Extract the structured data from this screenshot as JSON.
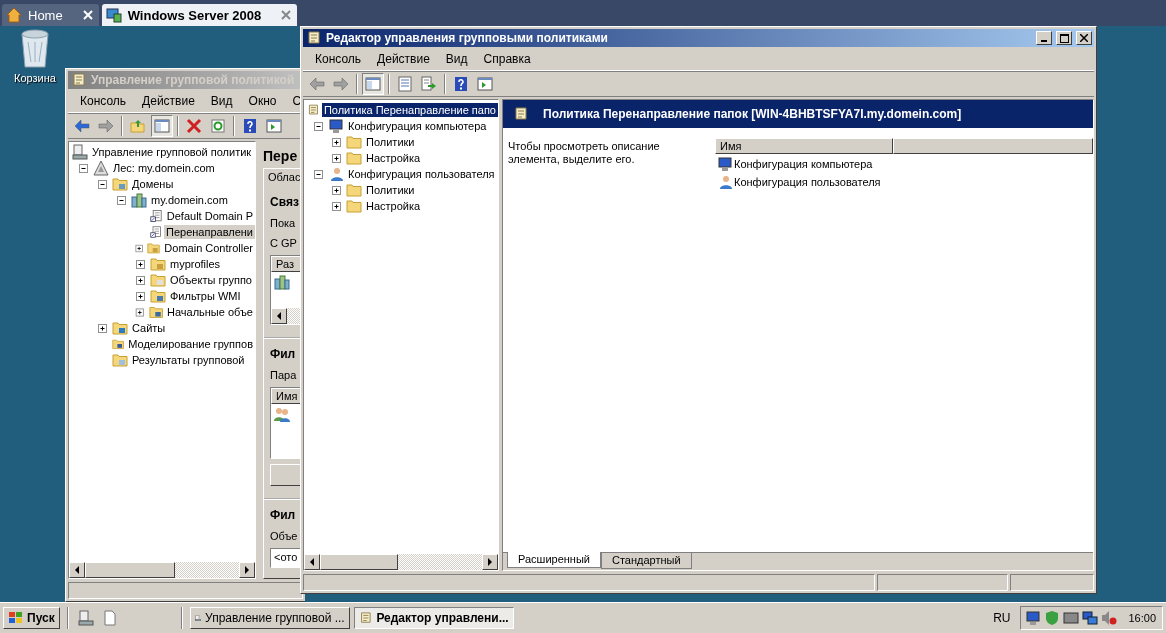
{
  "browser_tabs": [
    {
      "label": "Home",
      "selected": false
    },
    {
      "label": "Windows Server 2008",
      "selected": true
    }
  ],
  "desktop_icons": [
    {
      "label": "Корзина"
    }
  ],
  "gpmc_window": {
    "title": "Управление групповой политикой",
    "active": false,
    "menu": [
      "Консоль",
      "Действие",
      "Вид",
      "Окно",
      "С"
    ],
    "toolbar": [
      {
        "kind": "back",
        "disabled": false,
        "pressed": false
      },
      {
        "kind": "forward",
        "disabled": true,
        "pressed": false
      },
      {
        "kind": "separator"
      },
      {
        "kind": "up",
        "pressed": false
      },
      {
        "kind": "tree-toggle",
        "pressed": true
      },
      {
        "kind": "separator"
      },
      {
        "kind": "delete",
        "pressed": false
      },
      {
        "kind": "refresh",
        "pressed": false
      },
      {
        "kind": "separator"
      },
      {
        "kind": "help",
        "pressed": false
      },
      {
        "kind": "action-pane",
        "pressed": false
      }
    ],
    "tree": [
      {
        "label": "Управление групповой политик",
        "kind": "console",
        "selected": false,
        "children": [
          {
            "label": "Лес: my.domein.com",
            "kind": "forest",
            "expanded": true,
            "selected": false,
            "children": [
              {
                "label": "Домены",
                "kind": "domains",
                "expanded": true,
                "selected": false,
                "children": [
                  {
                    "label": "my.domein.com",
                    "kind": "domain",
                    "expanded": true,
                    "selected": false,
                    "children": [
                      {
                        "label": "Default Domain P",
                        "kind": "gpo",
                        "selected": false
                      },
                      {
                        "label": "Перенаправлени",
                        "kind": "gpo",
                        "selected": true
                      },
                      {
                        "label": "Domain Controller",
                        "kind": "ou",
                        "expanded": false,
                        "selected": false
                      },
                      {
                        "label": "myprofiles",
                        "kind": "ou",
                        "expanded": false,
                        "selected": false
                      },
                      {
                        "label": "Объекты группо",
                        "kind": "gpo-folder",
                        "expanded": false,
                        "selected": false
                      },
                      {
                        "label": "Фильтры WMI",
                        "kind": "wmi-folder",
                        "expanded": false,
                        "selected": false
                      },
                      {
                        "label": "Начальные объе",
                        "kind": "starter-folder",
                        "expanded": false,
                        "selected": false
                      }
                    ]
                  }
                ]
              },
              {
                "label": "Сайты",
                "kind": "sites",
                "expanded": false,
                "selected": false
              },
              {
                "label": "Моделирование группов",
                "kind": "modeling",
                "selected": false
              },
              {
                "label": "Результаты групповой",
                "kind": "results",
                "selected": false
              }
            ]
          }
        ]
      }
    ],
    "details": [
      {
        "kind": "title",
        "text": "Пере"
      },
      {
        "kind": "tab",
        "text": "Облас"
      },
      {
        "kind": "heading",
        "text": "Связ"
      },
      {
        "kind": "text",
        "text": "Пока"
      },
      {
        "kind": "text",
        "text": "С GP"
      },
      {
        "kind": "list",
        "header": "Раз",
        "scrollbar": true,
        "rows": [
          {
            "kind": "domain"
          }
        ]
      },
      {
        "kind": "heading",
        "text": "Фил"
      },
      {
        "kind": "text",
        "text": "Пара"
      },
      {
        "kind": "list",
        "header": "Имя",
        "scrollbar": false,
        "rows": [
          {
            "kind": "users"
          }
        ]
      },
      {
        "kind": "button"
      },
      {
        "kind": "heading",
        "text": "Фил"
      },
      {
        "kind": "text",
        "text": "Объе"
      },
      {
        "kind": "field",
        "value": "<ото"
      }
    ]
  },
  "editor_window": {
    "title": "Редактор управления групповыми политиками",
    "active": true,
    "menu": [
      "Консоль",
      "Действие",
      "Вид",
      "Справка"
    ],
    "toolbar": [
      {
        "kind": "back",
        "disabled": true,
        "pressed": false
      },
      {
        "kind": "forward",
        "disabled": true,
        "pressed": false
      },
      {
        "kind": "separator"
      },
      {
        "kind": "tree-toggle",
        "pressed": true
      },
      {
        "kind": "separator"
      },
      {
        "kind": "properties",
        "pressed": false
      },
      {
        "kind": "export",
        "pressed": false
      },
      {
        "kind": "separator"
      },
      {
        "kind": "help",
        "pressed": false
      },
      {
        "kind": "action-pane",
        "pressed": false
      }
    ],
    "tree": [
      {
        "label": "Политика Перенаправление папо",
        "kind": "policy",
        "selected": true,
        "children": [
          {
            "label": "Конфигурация компьютера",
            "kind": "computer",
            "expanded": true,
            "selected": false,
            "children": [
              {
                "label": "Политики",
                "kind": "folder",
                "expanded": false,
                "selected": false
              },
              {
                "label": "Настройка",
                "kind": "folder",
                "expanded": false,
                "selected": false
              }
            ]
          },
          {
            "label": "Конфигурация пользователя",
            "kind": "user",
            "expanded": true,
            "selected": false,
            "children": [
              {
                "label": "Политики",
                "kind": "folder",
                "expanded": false,
                "selected": false
              },
              {
                "label": "Настройка",
                "kind": "folder",
                "expanded": false,
                "selected": false
              }
            ]
          }
        ]
      }
    ],
    "header": "Политика Перенаправление папок [WIN-4BHBTSFYA7I.my.domein.com]",
    "description": "Чтобы просмотреть описание элемента, выделите его.",
    "list": {
      "columns": [
        "Имя"
      ],
      "rows": [
        {
          "label": "Конфигурация компьютера",
          "kind": "computer"
        },
        {
          "label": "Конфигурация пользователя",
          "kind": "user"
        }
      ]
    },
    "view_tabs": [
      {
        "label": "Расширенный",
        "selected": true
      },
      {
        "label": "Стандартный",
        "selected": false
      }
    ]
  },
  "taskbar": {
    "start": "Пуск",
    "tasks": [
      {
        "label": "Управление групповой ...",
        "selected": false
      },
      {
        "label": "Редактор управлени...",
        "selected": true
      }
    ],
    "language": "RU",
    "clock": "16:00"
  }
}
